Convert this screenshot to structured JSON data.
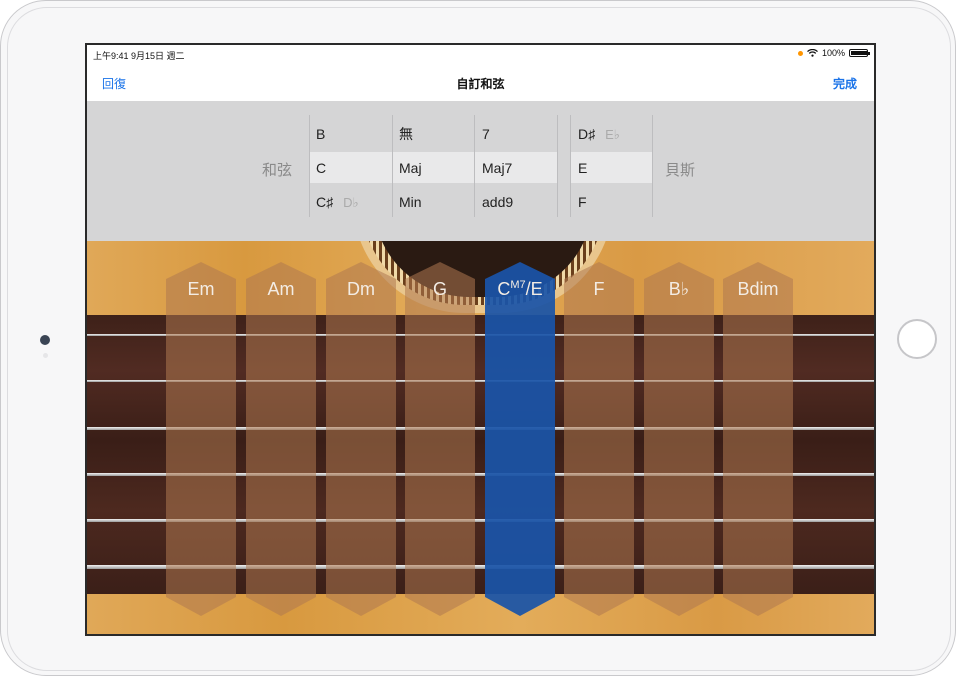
{
  "status_bar": {
    "time_date": "上午9:41 9月15日 週二",
    "battery": "100%",
    "battery_level": 1.0
  },
  "nav": {
    "back_label": "回復",
    "title": "自訂和弦",
    "done_label": "完成"
  },
  "picker": {
    "chord_label": "和弦",
    "bass_label": "貝斯",
    "root": [
      {
        "name": "B",
        "alt": ""
      },
      {
        "name": "C",
        "alt": ""
      },
      {
        "name": "C♯",
        "alt": "D♭"
      }
    ],
    "type": [
      "無",
      "Maj",
      "Min"
    ],
    "extension": [
      "7",
      "Maj7",
      "add9"
    ],
    "bass": [
      {
        "name": "D♯",
        "alt": "E♭"
      },
      {
        "name": "E",
        "alt": ""
      },
      {
        "name": "F",
        "alt": ""
      }
    ]
  },
  "chords": [
    {
      "base": "Em",
      "sup": "",
      "tail": ""
    },
    {
      "base": "Am",
      "sup": "",
      "tail": ""
    },
    {
      "base": "Dm",
      "sup": "",
      "tail": ""
    },
    {
      "base": "G",
      "sup": "",
      "tail": ""
    },
    {
      "base": "C",
      "sup": "M7",
      "tail": "/E"
    },
    {
      "base": "F",
      "sup": "",
      "tail": ""
    },
    {
      "base": "B♭",
      "sup": "",
      "tail": ""
    },
    {
      "base": "Bdim",
      "sup": "",
      "tail": ""
    }
  ],
  "colors": {
    "accent": "#1a73e8",
    "active_chord": "#1a54a8"
  }
}
